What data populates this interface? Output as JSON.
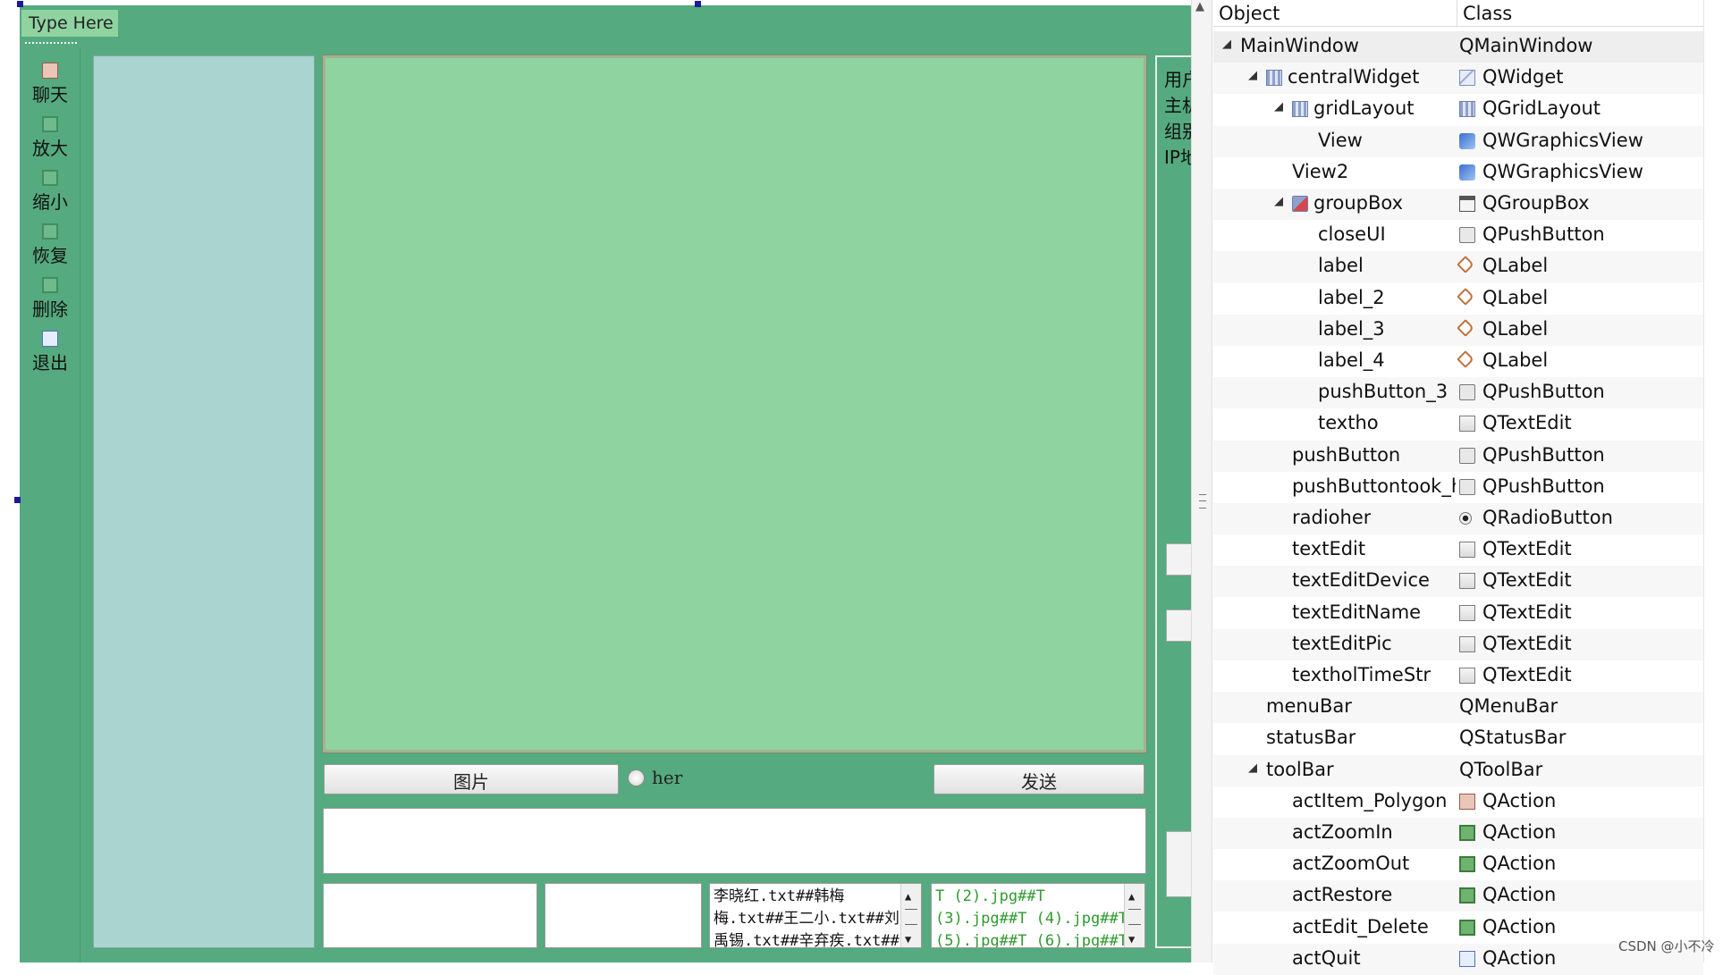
{
  "designer": {
    "menubar_placeholder": "Type Here",
    "toolbar_actions": [
      {
        "label": "聊天",
        "icon": "picture-icon"
      },
      {
        "label": "放大",
        "icon": "zoom-in-icon"
      },
      {
        "label": "缩小",
        "icon": "zoom-out-icon"
      },
      {
        "label": "恢复",
        "icon": "restore-icon"
      },
      {
        "label": "删除",
        "icon": "delete-icon"
      },
      {
        "label": "退出",
        "icon": "quit-icon"
      }
    ],
    "picture_button": "图片",
    "radio_label": "her",
    "send_button": "发送",
    "list_text_lines": [
      "李晓红.txt##韩梅",
      "梅.txt##王二小.txt##刘",
      "禹锡.txt##辛弃疾.txt##"
    ],
    "pic_text_lines": [
      "T (2).jpg##T",
      "(3).jpg##T (4).jpg##T",
      "(5).jpg##T (6).jpg##T"
    ],
    "group_labels": [
      "用户",
      "主机",
      "组别",
      "IP地"
    ],
    "colors": {
      "form_bg": "#55aa7f",
      "view_bg": "#8fd3a1",
      "left_panel_bg": "#aad4cf"
    }
  },
  "inspector": {
    "columns": {
      "object": "Object",
      "class": "Class"
    },
    "rows": [
      {
        "object": "MainWindow",
        "class": "QMainWindow",
        "depth": 0,
        "expanded": true,
        "obj_icon": "",
        "class_icon": ""
      },
      {
        "object": "centralWidget",
        "class": "QWidget",
        "depth": 1,
        "expanded": true,
        "obj_icon": "grid-layout-icon",
        "class_icon": "widget-icon"
      },
      {
        "object": "gridLayout",
        "class": "QGridLayout",
        "depth": 2,
        "expanded": true,
        "obj_icon": "grid-layout-icon",
        "class_icon": "grid-layout-icon"
      },
      {
        "object": "View",
        "class": "QWGraphicsView",
        "depth": 3,
        "obj_icon": "",
        "class_icon": "graphics-view-icon"
      },
      {
        "object": "View2",
        "class": "QWGraphicsView",
        "depth": 2,
        "obj_icon": "",
        "class_icon": "graphics-view-icon"
      },
      {
        "object": "groupBox",
        "class": "QGroupBox",
        "depth": 2,
        "expanded": true,
        "obj_icon": "groupbox-layout-icon",
        "class_icon": "groupbox-icon"
      },
      {
        "object": "closeUI",
        "class": "QPushButton",
        "depth": 3,
        "obj_icon": "",
        "class_icon": "push-button-icon"
      },
      {
        "object": "label",
        "class": "QLabel",
        "depth": 3,
        "obj_icon": "",
        "class_icon": "label-icon"
      },
      {
        "object": "label_2",
        "class": "QLabel",
        "depth": 3,
        "obj_icon": "",
        "class_icon": "label-icon"
      },
      {
        "object": "label_3",
        "class": "QLabel",
        "depth": 3,
        "obj_icon": "",
        "class_icon": "label-icon"
      },
      {
        "object": "label_4",
        "class": "QLabel",
        "depth": 3,
        "obj_icon": "",
        "class_icon": "label-icon"
      },
      {
        "object": "pushButton_3",
        "class": "QPushButton",
        "depth": 3,
        "obj_icon": "",
        "class_icon": "push-button-icon"
      },
      {
        "object": "textho",
        "class": "QTextEdit",
        "depth": 3,
        "obj_icon": "",
        "class_icon": "text-edit-icon"
      },
      {
        "object": "pushButton",
        "class": "QPushButton",
        "depth": 2,
        "obj_icon": "",
        "class_icon": "push-button-icon"
      },
      {
        "object": "pushButtontook_hol",
        "class": "QPushButton",
        "depth": 2,
        "obj_icon": "",
        "class_icon": "push-button-icon"
      },
      {
        "object": "radioher",
        "class": "QRadioButton",
        "depth": 2,
        "obj_icon": "",
        "class_icon": "radio-button-icon"
      },
      {
        "object": "textEdit",
        "class": "QTextEdit",
        "depth": 2,
        "obj_icon": "",
        "class_icon": "text-edit-icon"
      },
      {
        "object": "textEditDevice",
        "class": "QTextEdit",
        "depth": 2,
        "obj_icon": "",
        "class_icon": "text-edit-icon"
      },
      {
        "object": "textEditName",
        "class": "QTextEdit",
        "depth": 2,
        "obj_icon": "",
        "class_icon": "text-edit-icon"
      },
      {
        "object": "textEditPic",
        "class": "QTextEdit",
        "depth": 2,
        "obj_icon": "",
        "class_icon": "text-edit-icon"
      },
      {
        "object": "textholTimeStr",
        "class": "QTextEdit",
        "depth": 2,
        "obj_icon": "",
        "class_icon": "text-edit-icon"
      },
      {
        "object": "menuBar",
        "class": "QMenuBar",
        "depth": 1,
        "obj_icon": "",
        "class_icon": ""
      },
      {
        "object": "statusBar",
        "class": "QStatusBar",
        "depth": 1,
        "obj_icon": "",
        "class_icon": ""
      },
      {
        "object": "toolBar",
        "class": "QToolBar",
        "depth": 1,
        "expanded": true,
        "obj_icon": "",
        "class_icon": ""
      },
      {
        "object": "actItem_Polygon",
        "class": "QAction",
        "depth": 2,
        "obj_icon": "",
        "class_icon": "picture-icon"
      },
      {
        "object": "actZoomIn",
        "class": "QAction",
        "depth": 2,
        "obj_icon": "",
        "class_icon": "action-icon"
      },
      {
        "object": "actZoomOut",
        "class": "QAction",
        "depth": 2,
        "obj_icon": "",
        "class_icon": "action-icon"
      },
      {
        "object": "actRestore",
        "class": "QAction",
        "depth": 2,
        "obj_icon": "",
        "class_icon": "action-icon"
      },
      {
        "object": "actEdit_Delete",
        "class": "QAction",
        "depth": 2,
        "obj_icon": "",
        "class_icon": "action-icon"
      },
      {
        "object": "actQuit",
        "class": "QAction",
        "depth": 2,
        "obj_icon": "",
        "class_icon": "quit-icon"
      }
    ]
  },
  "watermark": "CSDN @小不冷"
}
